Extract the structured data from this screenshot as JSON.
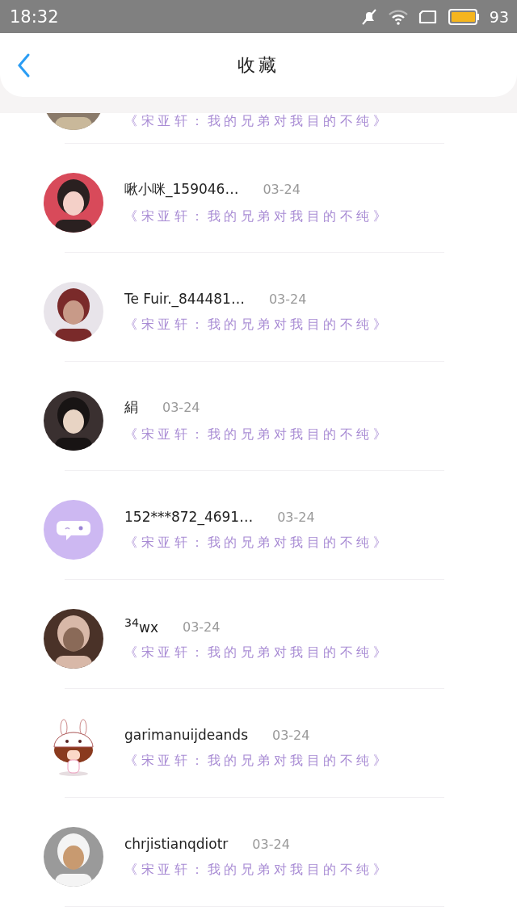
{
  "status_bar": {
    "time": "18:32",
    "battery": "93"
  },
  "header": {
    "title": "收藏"
  },
  "items": [
    {
      "title": "《宋亚轩：我的兄弟对我目的不纯》"
    },
    {
      "name": "啾小咪_159046…",
      "date": "03-24",
      "title": "《宋亚轩：我的兄弟对我目的不纯》"
    },
    {
      "name": "Te Fuir._844481…",
      "date": "03-24",
      "title": "《宋亚轩：我的兄弟对我目的不纯》"
    },
    {
      "name": "絹",
      "date": "03-24",
      "title": "《宋亚轩：我的兄弟对我目的不纯》"
    },
    {
      "avatar": {
        "kind": "default"
      },
      "name": "152***872_4691…",
      "date": "03-24",
      "title": "《宋亚轩：我的兄弟对我目的不纯》"
    },
    {
      "name": "$^{34}$wx",
      "date": "03-24",
      "title": "《宋亚轩：我的兄弟对我目的不纯》"
    },
    {
      "avatar": {
        "kind": "cartoon"
      },
      "name": "garimanuijdeands",
      "date": "03-24",
      "title": "《宋亚轩：我的兄弟对我目的不纯》"
    },
    {
      "name": "chrjistianqdiotr",
      "date": "03-24",
      "title": "《宋亚轩：我的兄弟对我目的不纯》"
    }
  ]
}
